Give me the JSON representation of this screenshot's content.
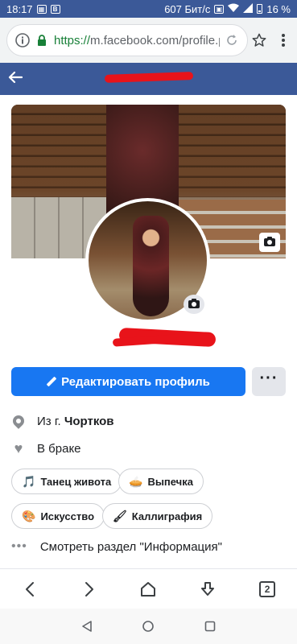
{
  "status_bar": {
    "time": "18:17",
    "network_speed": "607 Бит/с",
    "battery_percent": "16 %"
  },
  "browser": {
    "url_scheme": "https://",
    "url_rest": "m.facebook.com/profile.p"
  },
  "profile": {
    "edit_button_label": "Редактировать профиль",
    "more_button_label": "···",
    "hometown_prefix": "Из г.",
    "hometown_city": "Чортков",
    "relationship": "В браке",
    "interests": [
      {
        "emoji": "🎵",
        "label": "Танец живота"
      },
      {
        "emoji": "🥧",
        "label": "Выпечка"
      },
      {
        "emoji": "🎨",
        "label": "Искусство"
      },
      {
        "emoji": "🖌",
        "label": "Каллиграфия"
      }
    ],
    "see_info_label": "Смотреть раздел \"Информация\""
  },
  "browser_nav": {
    "tabs_count": "2"
  }
}
